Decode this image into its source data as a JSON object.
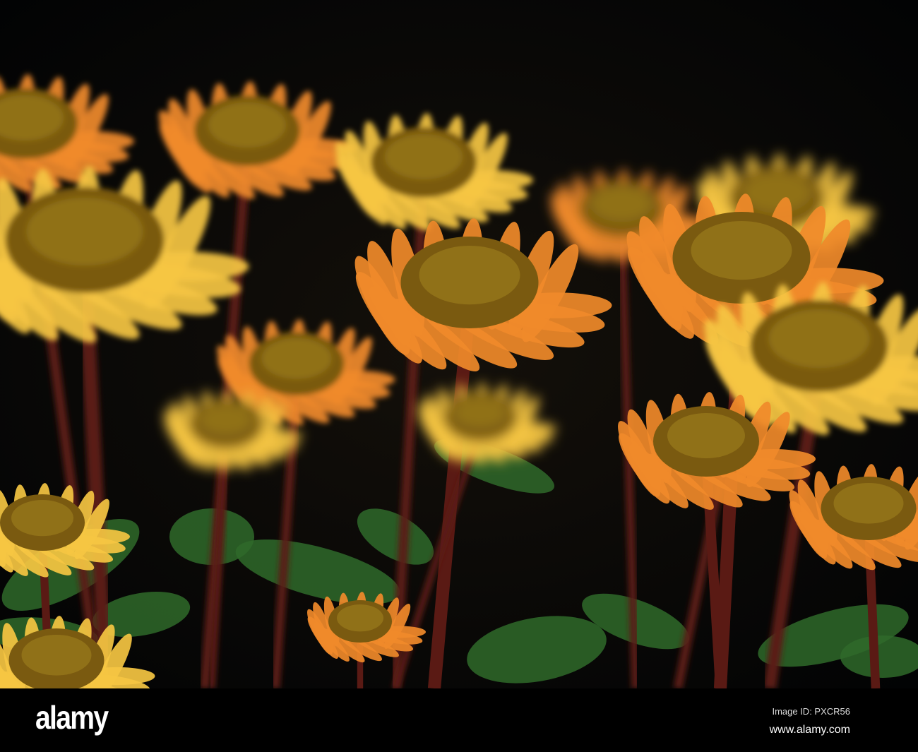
{
  "watermark": {
    "logo": "alamy",
    "image_id": "Image ID: PXCR56",
    "url": "www.alamy.com"
  },
  "colors": {
    "background": "#000000",
    "petal_orange": "#f08a2a",
    "petal_yellow": "#f5c542",
    "cone": "#7a5a10",
    "stem": "#5a1a14",
    "leaf": "#2f6a2a"
  }
}
